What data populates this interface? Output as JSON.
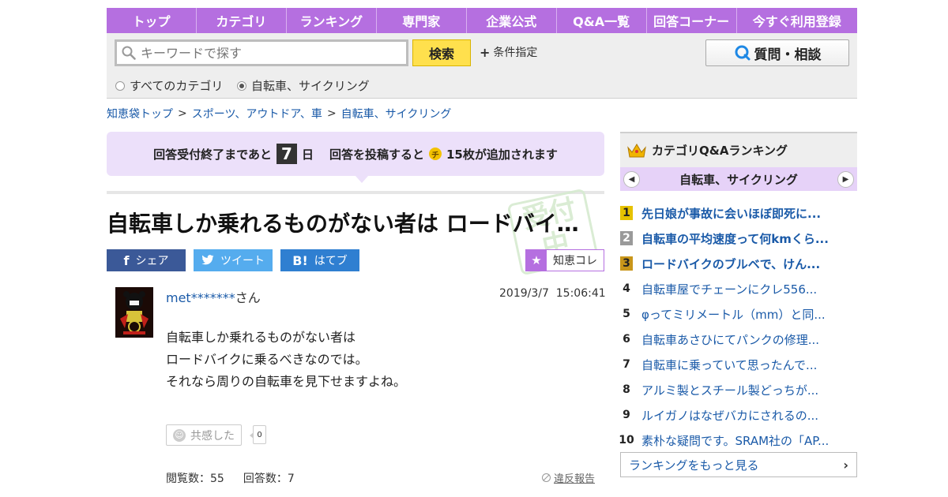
{
  "nav": {
    "items": [
      "トップ",
      "カテゴリ",
      "ランキング",
      "専門家",
      "企業公式",
      "Q&A一覧",
      "回答コーナー",
      "今すぐ利用登録"
    ]
  },
  "search": {
    "placeholder": "キーワードで探す",
    "button_label": "検索",
    "condition_label": "条件指定",
    "ask_button_label": "質問・相談",
    "scope_all": "すべてのカテゴリ",
    "scope_current": "自転車、サイクリング",
    "selected_scope": "自転車、サイクリング"
  },
  "breadcrumb": {
    "items": [
      "知恵袋トップ",
      "スポーツ、アウトドア、車",
      "自転車、サイクリング"
    ]
  },
  "notice": {
    "prefix": "回答受付終了まであと",
    "days": "7",
    "day_unit": "日",
    "middle": "回答を投稿すると",
    "coin_glyph": "チ",
    "suffix": "15枚が追加されます"
  },
  "question": {
    "title": "自転車しか乗れるものがない者は ロードバイ…",
    "stamp_text": "受付中",
    "user_name": "met*******",
    "user_suffix": "さん",
    "posted_at": "2019/3/7  15:06:41",
    "body_lines": [
      "自転車しか乗れるものがない者は",
      "ロードバイクに乗るべきなのでは。",
      "それなら周りの自転車を見下せますよね。"
    ],
    "empathy_label": "共感した",
    "empathy_count": "0",
    "views": "閲覧数：55",
    "answers": "回答数：7",
    "report_label": "違反報告"
  },
  "share": {
    "facebook_label": "シェア",
    "twitter_label": "ツイート",
    "hatena_label": "はてブ",
    "hatena_glyph": "B!",
    "chie_colle_label": "知恵コレ"
  },
  "ranking": {
    "title": "カテゴリQ&Aランキング",
    "category": "自転車、サイクリング",
    "items": [
      {
        "rank": "1",
        "text": "先日娘が事故に会いほぼ即死に..."
      },
      {
        "rank": "2",
        "text": "自転車の平均速度って何kmくら..."
      },
      {
        "rank": "3",
        "text": "ロードバイクのブルベで、けん..."
      },
      {
        "rank": "4",
        "text": "自転車屋でチェーンにクレ556..."
      },
      {
        "rank": "5",
        "text": "φってミリメートル（mm）と同..."
      },
      {
        "rank": "6",
        "text": "自転車あさひにてパンクの修理..."
      },
      {
        "rank": "7",
        "text": "自転車に乗っていて思ったんで..."
      },
      {
        "rank": "8",
        "text": "アルミ製とスチール製どっちが..."
      },
      {
        "rank": "9",
        "text": "ルイガノはなぜバカにされるの..."
      },
      {
        "rank": "10",
        "text": "素朴な疑問です。SRAM社の「AP..."
      }
    ],
    "more_label": "ランキングをもっと見る"
  },
  "colors": {
    "accent_purple": "#b56fe0",
    "search_yellow": "#ffe04d",
    "link_blue": "#1a5aa8"
  }
}
